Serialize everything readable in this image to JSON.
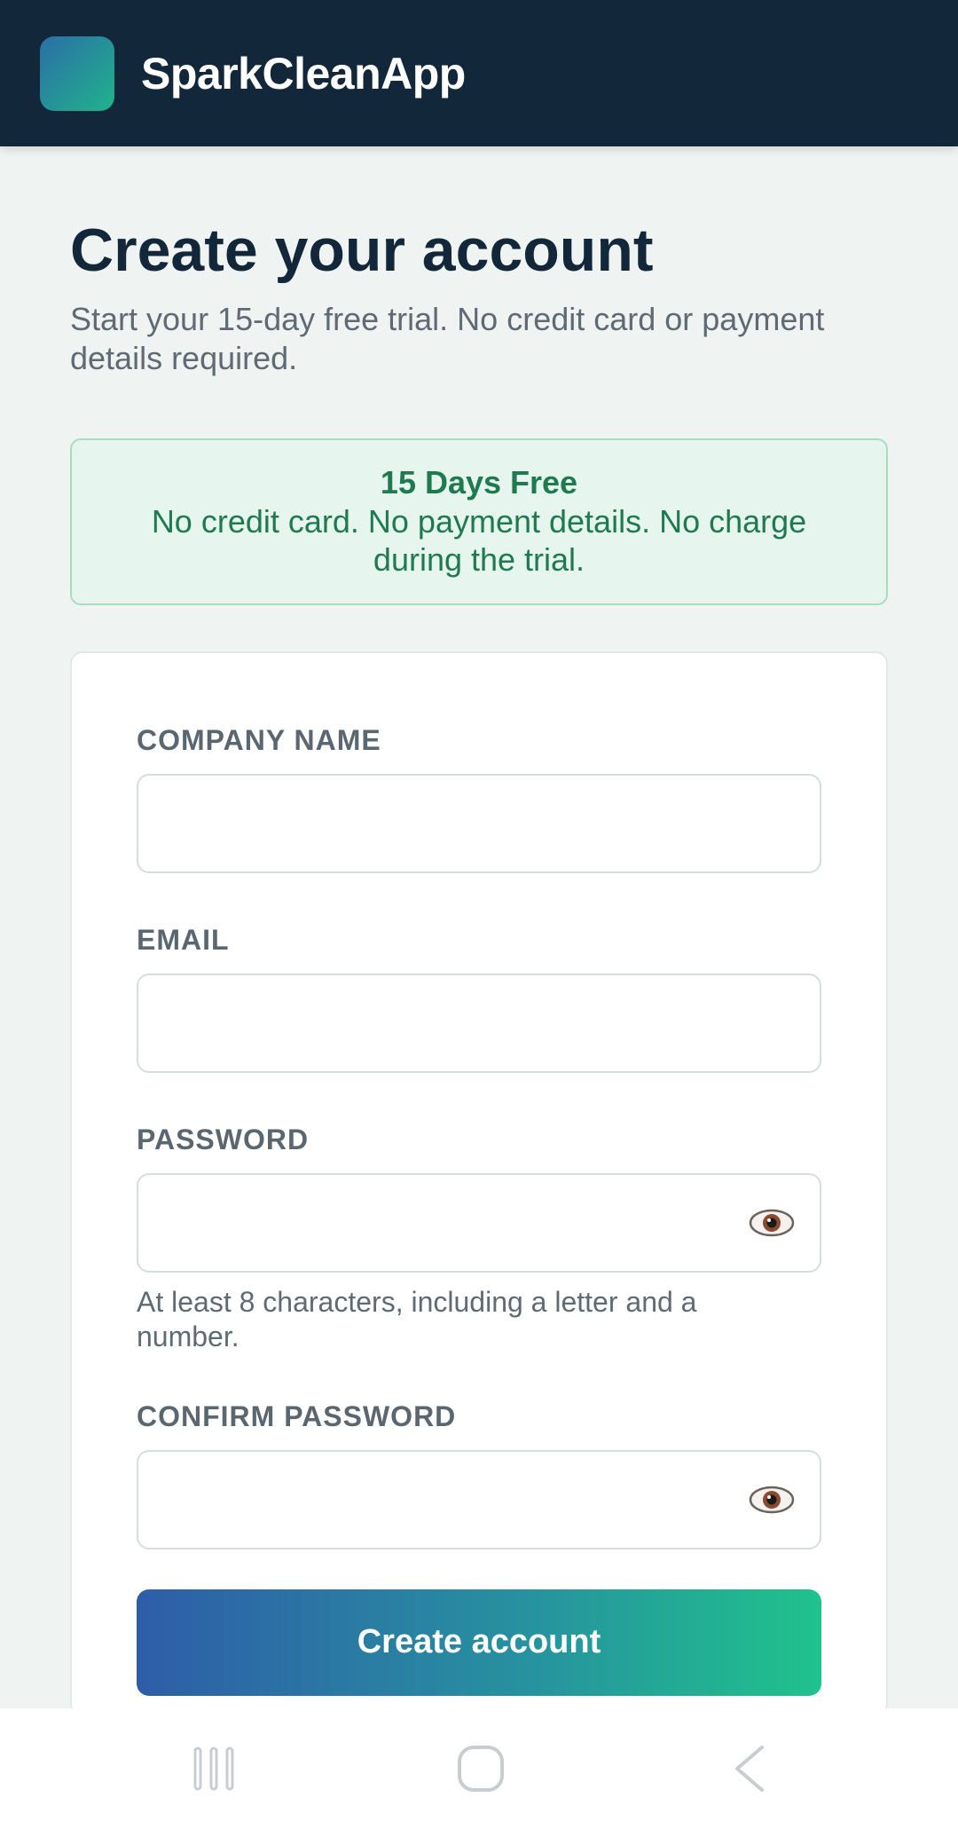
{
  "header": {
    "brand": "SparkCleanApp"
  },
  "page": {
    "title": "Create your account",
    "subtitle": "Start your 15-day free trial. No credit card or payment details required."
  },
  "banner": {
    "title": "15 Days Free",
    "text": "No credit card. No payment details. No charge during the trial."
  },
  "form": {
    "company_label": "COMPANY NAME",
    "company_value": "",
    "email_label": "EMAIL",
    "email_value": "",
    "password_label": "PASSWORD",
    "password_value": "",
    "password_hint": "At least 8 characters, including a letter and a number.",
    "confirm_label": "CONFIRM PASSWORD",
    "confirm_value": "",
    "submit_label": "Create account"
  },
  "icons": {
    "logo": "app-logo",
    "password_toggle": "eye-icon",
    "nav_recent": "recent-apps-icon",
    "nav_home": "home-icon",
    "nav_back": "back-icon"
  },
  "colors": {
    "header_bg": "#13273a",
    "accent_start": "#2e5da8",
    "accent_end": "#20c28c",
    "success_text": "#1f7a4f",
    "success_bg": "#e6f5ee"
  }
}
